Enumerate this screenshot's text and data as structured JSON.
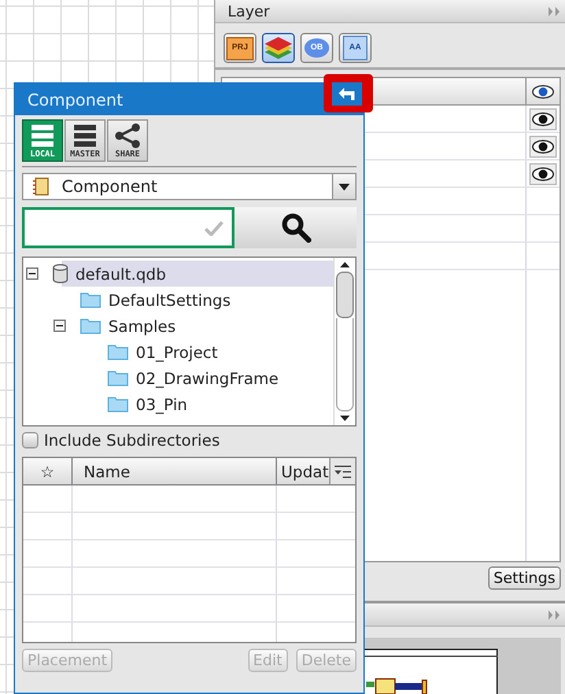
{
  "layer_panel": {
    "title": "Layer",
    "toolbar": [
      {
        "kind": "project",
        "label": "PRJ",
        "selected": false
      },
      {
        "kind": "layers",
        "selected": true
      },
      {
        "kind": "bubble",
        "label": "OB",
        "selected": false
      },
      {
        "kind": "text",
        "label": "AA",
        "selected": false
      }
    ],
    "rows": [
      {
        "visible": true
      },
      {
        "visible": true
      },
      {
        "visible": true
      }
    ],
    "settings_button": "Settings"
  },
  "component_window": {
    "title": "Component",
    "highlighted": true,
    "tabs": [
      {
        "label": "LOCAL",
        "kind": "list",
        "selected": true
      },
      {
        "label": "MASTER",
        "kind": "list",
        "selected": false
      },
      {
        "label": "SHARE",
        "kind": "share",
        "selected": false
      }
    ],
    "category_dropdown": {
      "value": "Component"
    },
    "tree": [
      {
        "label": "default.qdb",
        "kind": "database",
        "expanded": true,
        "selected": true,
        "children": [
          {
            "label": "DefaultSettings",
            "kind": "folder",
            "selected": false
          },
          {
            "label": "Samples",
            "kind": "folder",
            "expanded": true,
            "selected": false,
            "children": [
              {
                "label": "01_Project",
                "kind": "folder",
                "selected": false
              },
              {
                "label": "02_DrawingFrame",
                "kind": "folder",
                "selected": false
              },
              {
                "label": "03_Pin",
                "kind": "folder",
                "selected": false
              }
            ]
          }
        ]
      }
    ],
    "include_subdirectories": {
      "label": "Include Subdirectories",
      "checked": false
    },
    "table": {
      "columns": [
        "☆",
        "Name",
        "Updat"
      ]
    },
    "buttons": [
      {
        "label": "Placement",
        "disabled": true
      },
      {
        "label": "Edit",
        "disabled": true
      },
      {
        "label": "Delete",
        "disabled": true
      }
    ]
  }
}
